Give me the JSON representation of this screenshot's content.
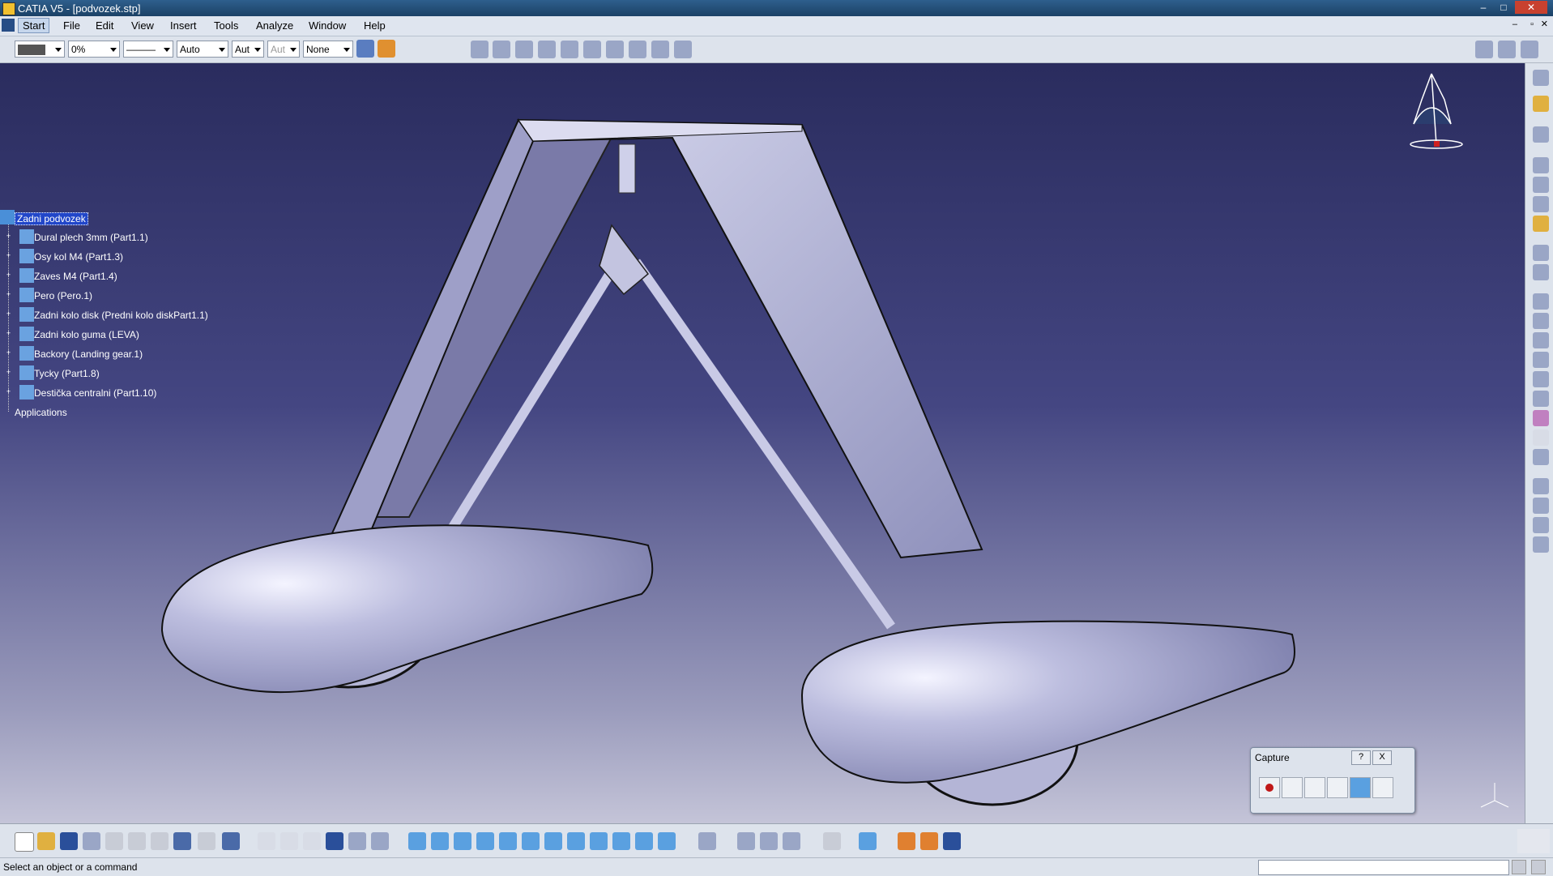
{
  "window": {
    "title": "CATIA V5 - [podvozek.stp]"
  },
  "menu": {
    "items": [
      "Start",
      "File",
      "Edit",
      "View",
      "Insert",
      "Tools",
      "Analyze",
      "Window",
      "Help"
    ]
  },
  "toolbar": {
    "color_value": "",
    "transparency_value": "0%",
    "linetype_value": "———",
    "thickness_value": "Auto",
    "point_value": "Aut",
    "layer_value": "Aut",
    "layer2_value": "None"
  },
  "tree": {
    "root": "Zadni podvozek",
    "children": [
      "Dural plech 3mm (Part1.1)",
      "Osy kol M4 (Part1.3)",
      "Zaves M4 (Part1.4)",
      "Pero (Pero.1)",
      "Zadni kolo disk (Predni kolo diskPart1.1)",
      "Zadni kolo guma (LEVA)",
      "Backory (Landing gear.1)",
      "Tycky (Part1.8)",
      "Destička centralni (Part1.10)"
    ],
    "applications": "Applications"
  },
  "capture": {
    "title": "Capture",
    "help": "?",
    "close": "X"
  },
  "status": {
    "message": "Select an object or a command"
  },
  "colors": {
    "viewport_top": "#2a2c5e",
    "viewport_bottom": "#c4c4d8",
    "model": "#b4b5d6",
    "selection": "#2146c9"
  }
}
